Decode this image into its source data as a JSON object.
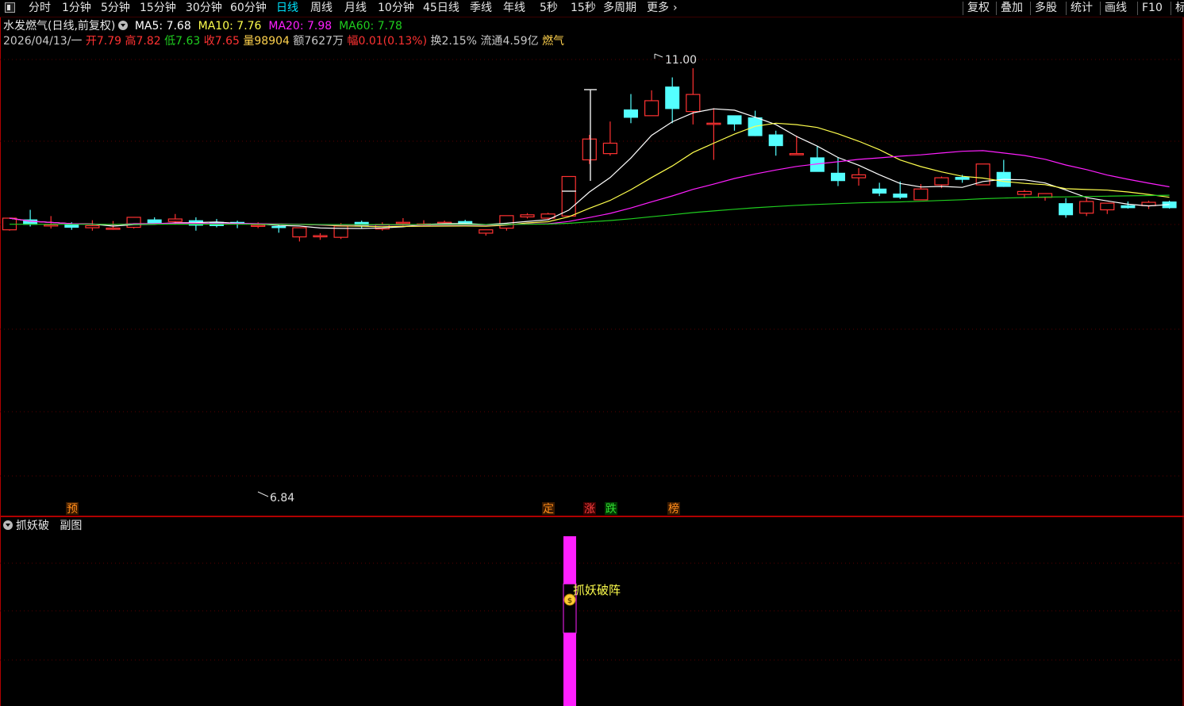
{
  "toolbar": {
    "periods": [
      "分时",
      "1分钟",
      "5分钟",
      "15分钟",
      "30分钟",
      "60分钟",
      "日线",
      "周线",
      "月线",
      "10分钟",
      "45日线",
      "季线",
      "年线",
      "5秒",
      "15秒",
      "多周期",
      "更多"
    ],
    "active_period": "日线",
    "more_arrow": "›",
    "right_buttons": [
      "复权",
      "叠加",
      "多股",
      "统计",
      "画线",
      "F10",
      "标"
    ]
  },
  "header": {
    "stock_name": "水发燃气(日线,前复权)",
    "ma5_label": "MA5:",
    "ma5_value": "7.68",
    "ma10_label": "MA10:",
    "ma10_value": "7.76",
    "ma20_label": "MA20:",
    "ma20_value": "7.98",
    "ma60_label": "MA60:",
    "ma60_value": "7.78",
    "date": "2026/04/13/一",
    "open_label": "开",
    "open_value": "7.79",
    "high_label": "高",
    "high_value": "7.82",
    "low_label": "低",
    "low_value": "7.63",
    "close_label": "收",
    "close_value": "7.65",
    "volume_label": "量",
    "volume_value": "98904",
    "amount_label": "额",
    "amount_value": "7627万",
    "range_label": "幅",
    "range_value": "0.01(0.13%)",
    "turnover_label": "换",
    "turnover_value": "2.15%",
    "float_label": "流通",
    "float_value": "4.59亿",
    "sector": "燃气"
  },
  "price_chart": {
    "high_marker": "11.00",
    "low_marker": "6.84",
    "event_tags": [
      "预",
      "定",
      "涨",
      "跌",
      "榜"
    ]
  },
  "sub_panel": {
    "indicator_name": "抓妖破",
    "label": "副图",
    "signal_text": "抓妖破阵",
    "signal_icon": "coin-icon"
  },
  "colors": {
    "up": "#ff3232",
    "down": "#54ffff",
    "ma5": "#ffffff",
    "ma10": "#ffff4d",
    "ma20": "#ff1fff",
    "ma60": "#1fce1f",
    "panel_border": "#b00000",
    "signal_bar": "#ff1fff"
  },
  "chart_data": {
    "type": "candlestick",
    "ohlc": [
      [
        7.12,
        7.4,
        7.1,
        7.4
      ],
      [
        7.36,
        7.6,
        7.2,
        7.25
      ],
      [
        7.22,
        7.45,
        7.15,
        7.24
      ],
      [
        7.24,
        7.3,
        7.12,
        7.18
      ],
      [
        7.17,
        7.35,
        7.1,
        7.22
      ],
      [
        7.16,
        7.33,
        7.12,
        7.16
      ],
      [
        7.18,
        7.42,
        7.15,
        7.42
      ],
      [
        7.36,
        7.42,
        7.28,
        7.28
      ],
      [
        7.32,
        7.5,
        7.26,
        7.38
      ],
      [
        7.34,
        7.42,
        7.1,
        7.23
      ],
      [
        7.3,
        7.38,
        7.18,
        7.22
      ],
      [
        7.3,
        7.34,
        7.16,
        7.26
      ],
      [
        7.22,
        7.3,
        7.16,
        7.23
      ],
      [
        7.2,
        7.24,
        7.05,
        7.18
      ],
      [
        6.95,
        7.17,
        6.84,
        7.17
      ],
      [
        6.96,
        7.04,
        6.88,
        6.98
      ],
      [
        6.94,
        7.28,
        6.9,
        7.21
      ],
      [
        7.3,
        7.34,
        7.16,
        7.22
      ],
      [
        7.14,
        7.3,
        7.1,
        7.25
      ],
      [
        7.3,
        7.4,
        7.22,
        7.3
      ],
      [
        7.25,
        7.35,
        7.2,
        7.26
      ],
      [
        7.29,
        7.34,
        7.24,
        7.3
      ],
      [
        7.32,
        7.36,
        7.24,
        7.25
      ],
      [
        7.04,
        7.1,
        6.98,
        7.12
      ],
      [
        7.16,
        7.46,
        7.1,
        7.46
      ],
      [
        7.43,
        7.52,
        7.39,
        7.48
      ],
      [
        7.4,
        7.53,
        7.38,
        7.5
      ],
      [
        7.45,
        7.93,
        7.43,
        8.4
      ],
      [
        8.8,
        9.4,
        8.7,
        9.3
      ],
      [
        8.95,
        9.72,
        8.9,
        9.2
      ],
      [
        10.0,
        10.38,
        9.68,
        9.82
      ],
      [
        9.86,
        10.47,
        9.94,
        10.22
      ],
      [
        10.55,
        10.78,
        9.68,
        10.03
      ],
      [
        9.96,
        11.0,
        9.65,
        10.37
      ],
      [
        9.68,
        10.04,
        8.8,
        9.68
      ],
      [
        9.86,
        9.78,
        9.5,
        9.66
      ],
      [
        9.81,
        9.98,
        9.37,
        9.38
      ],
      [
        9.4,
        9.5,
        8.9,
        9.14
      ],
      [
        8.92,
        9.38,
        8.93,
        8.95
      ],
      [
        8.85,
        9.13,
        8.65,
        8.52
      ],
      [
        8.48,
        8.85,
        8.17,
        8.3
      ],
      [
        8.37,
        8.6,
        8.18,
        8.44
      ],
      [
        8.1,
        8.25,
        7.93,
        8.0
      ],
      [
        7.98,
        8.28,
        7.86,
        7.9
      ],
      [
        7.84,
        8.22,
        7.86,
        8.1
      ],
      [
        8.2,
        8.4,
        8.12,
        8.37
      ],
      [
        8.38,
        8.44,
        8.25,
        8.33
      ],
      [
        8.2,
        8.63,
        8.2,
        8.7
      ],
      [
        8.5,
        8.8,
        8.15,
        8.16
      ],
      [
        7.97,
        8.08,
        7.88,
        8.04
      ],
      [
        7.9,
        7.99,
        7.82,
        7.99
      ],
      [
        7.75,
        7.88,
        7.41,
        7.48
      ],
      [
        7.52,
        7.9,
        7.45,
        7.8
      ],
      [
        7.6,
        7.76,
        7.5,
        7.76
      ],
      [
        7.7,
        7.8,
        7.63,
        7.65
      ],
      [
        7.7,
        7.82,
        7.62,
        7.78
      ],
      [
        7.79,
        7.82,
        7.63,
        7.65
      ]
    ]
  }
}
